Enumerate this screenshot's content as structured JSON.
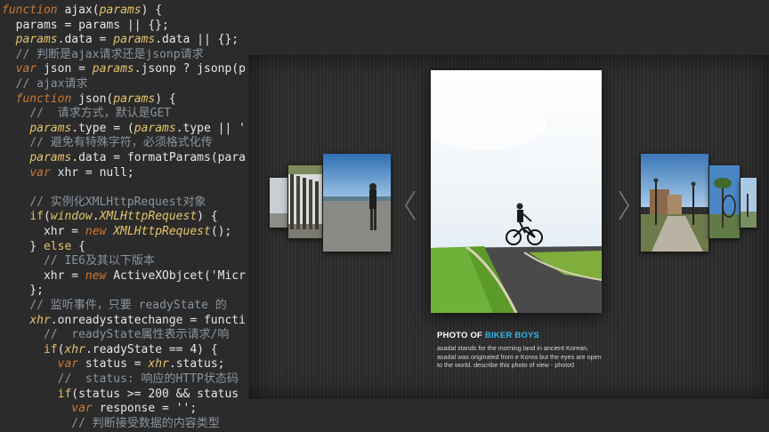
{
  "code_lines": [
    {
      "text": "function ajax(params) {",
      "indent": 0
    },
    {
      "text": "  params = params || {};",
      "indent": 0
    },
    {
      "text": "  params.data = params.data || {};",
      "indent": 0
    },
    {
      "text": "  // 判断是ajax请求还是jsonp请求",
      "indent": 0
    },
    {
      "text": "  var json = params.jsonp ? jsonp(p",
      "indent": 0
    },
    {
      "text": "  // ajax请求",
      "indent": 0
    },
    {
      "text": "  function json(params) {",
      "indent": 0
    },
    {
      "text": "    //  请求方式，默认是GET",
      "indent": 0
    },
    {
      "text": "    params.type = (params.type || '",
      "indent": 0
    },
    {
      "text": "    // 避免有特殊字符，必须格式化传",
      "indent": 0
    },
    {
      "text": "    params.data = formatParams(para",
      "indent": 0
    },
    {
      "text": "    var xhr = null;",
      "indent": 0
    },
    {
      "text": "",
      "indent": 0
    },
    {
      "text": "    // 实例化XMLHttpRequest对象",
      "indent": 0
    },
    {
      "text": "    if(window.XMLHttpRequest) {",
      "indent": 0
    },
    {
      "text": "      xhr = new XMLHttpRequest();",
      "indent": 0
    },
    {
      "text": "    } else {",
      "indent": 0
    },
    {
      "text": "      // IE6及其以下版本",
      "indent": 0
    },
    {
      "text": "      xhr = new ActiveXObjcet('Micr",
      "indent": 0
    },
    {
      "text": "    };",
      "indent": 0
    },
    {
      "text": "    // 监听事件，只要 readyState 的",
      "indent": 0
    },
    {
      "text": "    xhr.onreadystatechange = functi",
      "indent": 0
    },
    {
      "text": "      //  readyState属性表示请求/响",
      "indent": 0
    },
    {
      "text": "      if(xhr.readyState == 4) {",
      "indent": 0
    },
    {
      "text": "        var status = xhr.status;",
      "indent": 0
    },
    {
      "text": "        //  status: 响应的HTTP状态码",
      "indent": 0
    },
    {
      "text": "        if(status >= 200 && status",
      "indent": 0
    },
    {
      "text": "          var response = '';",
      "indent": 0
    },
    {
      "text": "          // 判断接受数据的内容类型",
      "indent": 0
    }
  ],
  "gallery": {
    "caption": {
      "title_prefix": "PHOTO OF ",
      "title_accent": "BIKER BOYS",
      "description": "asadal stands for the morning land in ancient Korean. asadal was originated from e Korea but the eyes are open to the world. describe this photo of view - photo0"
    },
    "prev_arrow_icon": "chevron-left-icon",
    "next_arrow_icon": "chevron-right-icon",
    "colors": {
      "accent": "#33b5e5",
      "panel_bg": "#2d2d2d"
    }
  }
}
